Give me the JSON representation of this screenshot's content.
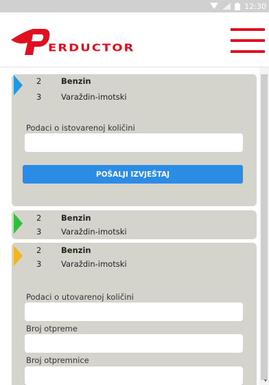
{
  "status_bar": {
    "time": "12:30"
  },
  "header": {
    "logo_text": "ERDUCTOR"
  },
  "orders": [
    {
      "marker_color": "#1e9be0",
      "rows": [
        {
          "num": "2",
          "text": "Benzin"
        },
        {
          "num": "3",
          "text": "Varaždin-imotski"
        }
      ],
      "fields": [
        {
          "label": "Podaci o istovarenoj količini",
          "value": ""
        }
      ],
      "button": "POŠALJI IZVJEŠTAJ"
    },
    {
      "marker_color": "#2fbf3a",
      "rows": [
        {
          "num": "2",
          "text": "Benzin"
        },
        {
          "num": "3",
          "text": "Varaždin-imotski"
        }
      ]
    },
    {
      "marker_color": "#f2b51d",
      "rows": [
        {
          "num": "2",
          "text": "Benzin"
        },
        {
          "num": "3",
          "text": "Varaždin-imotski"
        }
      ],
      "fields": [
        {
          "label": "Podaci o utovarenoj količini",
          "value": ""
        },
        {
          "label": "Broj otpreme",
          "value": ""
        },
        {
          "label": "Broj otpremnice",
          "value": ""
        }
      ]
    }
  ]
}
